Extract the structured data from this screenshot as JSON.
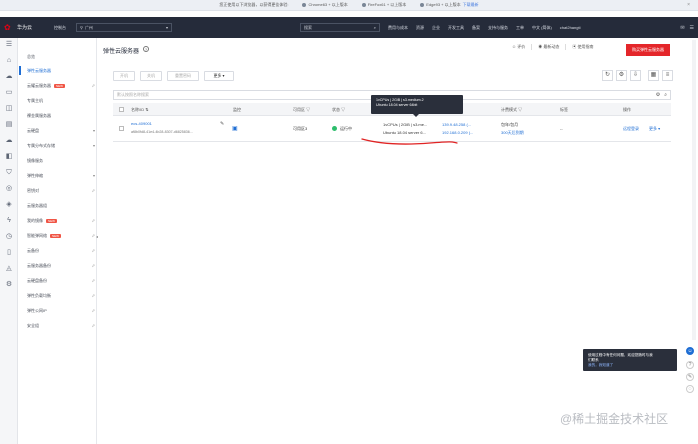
{
  "notice": {
    "text": "您正使用以下浏览器，以获得更佳体验:",
    "browsers": [
      {
        "label": "Chrome63 + 以上版本"
      },
      {
        "label": "FireFox61 + 以上版本"
      },
      {
        "label": "Edge93 + 以上版本"
      }
    ],
    "download_label": "下载最新",
    "close": "×"
  },
  "topnav": {
    "brand": "华为云",
    "console": "控制台",
    "region": "广州",
    "search_placeholder": "搜索",
    "menu": [
      "费用与成本",
      "资源",
      "企业",
      "开发工具",
      "备案",
      "支持与服务",
      "工单",
      "中文 (简体)",
      "chat2hangti"
    ]
  },
  "menu": {
    "items": [
      {
        "label": "总览",
        "right": ""
      },
      {
        "label": "弹性云服务器",
        "right": "",
        "active": true
      },
      {
        "label": "云耀云服务器",
        "badge": "NEW",
        "right": "⬀"
      },
      {
        "label": "专属主机",
        "right": ""
      },
      {
        "label": "裸金属服务器",
        "right": ""
      },
      {
        "label": "云硬盘",
        "right": "▾"
      },
      {
        "label": "专属分布式存储",
        "right": "▾"
      },
      {
        "label": "镜像服务",
        "right": ""
      },
      {
        "label": "弹性伸缩",
        "right": "▾"
      },
      {
        "label": "密钥对",
        "right": "⬀"
      },
      {
        "label": "云服务器组",
        "right": ""
      },
      {
        "label": "我的镜像",
        "badge": "NEW",
        "right": "⬀"
      },
      {
        "label": "智能弹网络",
        "badge": "NEW",
        "right": "⬀"
      },
      {
        "label": "云备份",
        "right": "⬀"
      },
      {
        "label": "云服务器备份",
        "right": "⬀"
      },
      {
        "label": "云硬盘备份",
        "right": "⬀"
      },
      {
        "label": "弹性负载均衡",
        "right": "⬀"
      },
      {
        "label": "弹性公网IP",
        "right": "⬀"
      },
      {
        "label": "安全组",
        "right": "⬀"
      }
    ]
  },
  "page": {
    "title": "弹性云服务器",
    "actions": [
      "评价",
      "最新动态",
      "使用指南"
    ],
    "buy_label": "购买弹性云服务器"
  },
  "toolbar": {
    "buttons": [
      "开机",
      "关机",
      "重置密码",
      "更多 ▾"
    ]
  },
  "filter": {
    "placeholder": "默认按照名称搜索"
  },
  "table": {
    "headers": [
      "名称/ID",
      "监控",
      "可用区",
      "状态",
      "规格/镜像",
      "IP地址",
      "计费模式",
      "标签",
      "操作"
    ],
    "row": {
      "name": "ecs-409001",
      "id": "af8b0fd8-41e4-4b28-8307-d6825836...",
      "az": "可用区3",
      "status": "运行中",
      "spec": "1vCPUs | 2GiB | s3.me...",
      "image": "Ubuntu 18.04 server 6...",
      "ip1": "139.9.48.258 (...",
      "ip2": "192.168.0.209 (...",
      "billing": "包年/包月",
      "billing_detail": "300天后到期",
      "tag": "--",
      "op1": "远程登录",
      "op2": "更多 ▾"
    }
  },
  "tooltip": {
    "line1": "1vCPUs | 2GiB | s3.medium.2",
    "line2": "Ubuntu 18.04 server 64bit"
  },
  "float_tip": {
    "line1": "使用过程中有任何问题，欢迎您随时与我",
    "line2": "们联系",
    "link": "我的，我知道了"
  },
  "watermark": "@稀土掘金技术社区",
  "colors": {
    "accent": "#1f6ed4",
    "buy": "#e4262a",
    "topbar": "#252b3a",
    "running": "#2dbd6c",
    "annotation": "#e02424"
  }
}
